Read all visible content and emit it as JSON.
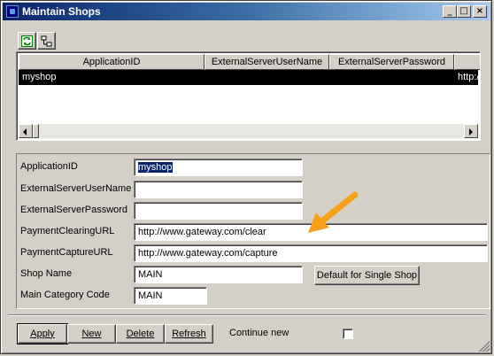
{
  "window": {
    "title": "Maintain Shops",
    "controls": {
      "minimize": "_",
      "maximize": "□",
      "close": "×"
    }
  },
  "toolbar": {
    "buttons": [
      {
        "name": "refresh-icon",
        "tooltip": ""
      },
      {
        "name": "tree-icon",
        "tooltip": ""
      }
    ]
  },
  "grid": {
    "columns": [
      "ApplicationID",
      "ExternalServerUserName",
      "ExternalServerPassword",
      ""
    ],
    "rows": [
      {
        "ApplicationID": "myshop",
        "tail": "http:/"
      }
    ]
  },
  "form": {
    "fields": [
      {
        "label": "ApplicationID",
        "value": "myshop"
      },
      {
        "label": "ExternalServerUserName",
        "value": ""
      },
      {
        "label": "ExternalServerPassword",
        "value": ""
      },
      {
        "label": "PaymentClearingURL",
        "value": "http://www.gateway.com/clear"
      },
      {
        "label": "PaymentCaptureURL",
        "value": "http://www.gateway.com/capture"
      },
      {
        "label": "Shop Name",
        "value": "MAIN"
      },
      {
        "label": "Main Category Code",
        "value": "MAIN"
      }
    ],
    "default_button": "Default for Single Shop"
  },
  "actions": {
    "apply": "Apply",
    "new": "New",
    "delete": "Delete",
    "refresh": "Refresh",
    "continue_new": "Continue new",
    "continue_new_checked": false
  },
  "colors": {
    "title_gradient_start": "#0a246a",
    "selection": "#000000",
    "annotation_arrow": "#f7a11a"
  }
}
